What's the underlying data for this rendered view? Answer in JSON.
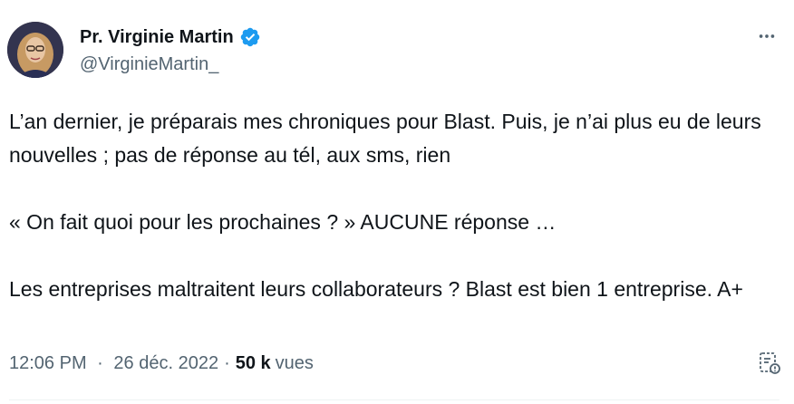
{
  "author": {
    "display_name": "Pr. Virginie Martin",
    "handle": "@VirginieMartin_",
    "verified": true,
    "verified_color": "#1d9bf0"
  },
  "tweet": {
    "text": "L’an dernier, je préparais mes chroniques pour Blast. Puis, je n’ai plus eu de leurs nouvelles ; pas de réponse au tél, aux sms, rien\n\n« On fait quoi pour les prochaines ? » AUCUNE réponse …\n\nLes entreprises maltraitent leurs collaborateurs ? Blast est bien 1 entreprise. A+",
    "time": "12:06 PM",
    "date": "26 déc. 2022",
    "separator": "·",
    "views_count": "50 k",
    "views_label": "vues"
  },
  "icons": {
    "more": "more-horizontal-icon",
    "verified": "verified-badge-icon",
    "analytics": "post-analytics-icon"
  },
  "colors": {
    "text_primary": "#0f1419",
    "text_secondary": "#536471",
    "accent": "#1d9bf0"
  }
}
